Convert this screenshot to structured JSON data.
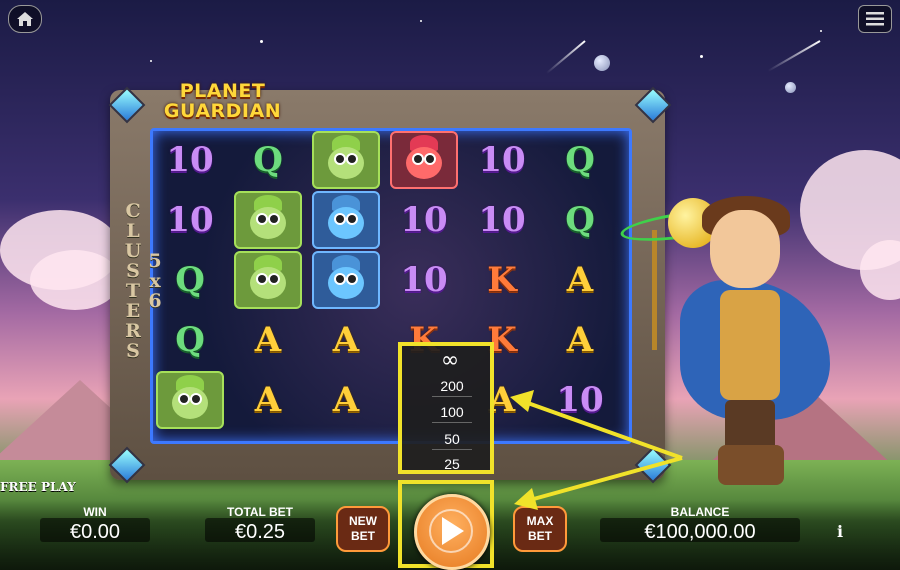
{
  "game": {
    "title_line1": "PLANET",
    "title_line2": "GUARDIAN",
    "side_label": "5x6 CLUSTERS"
  },
  "reels": [
    [
      "10",
      "Q",
      "creature-green",
      "creature-red",
      "10",
      "Q"
    ],
    [
      "10",
      "creature-green",
      "creature-blue",
      "10",
      "10",
      "Q"
    ],
    [
      "Q",
      "creature-green",
      "creature-blue",
      "10",
      "K",
      "A"
    ],
    [
      "Q",
      "A",
      "A",
      "K",
      "K",
      "A"
    ],
    [
      "creature-green",
      "A",
      "A",
      "",
      "A",
      "10"
    ]
  ],
  "autoplay": {
    "options": [
      "∞",
      "200",
      "100",
      "50",
      "25"
    ]
  },
  "bottom": {
    "free_play": "FREE PLAY",
    "win_label": "WIN",
    "win_value": "€0.00",
    "total_bet_label": "TOTAL BET",
    "total_bet_value": "€0.25",
    "new_bet_label_1": "NEW",
    "new_bet_label_2": "BET",
    "max_bet_label_1": "MAX",
    "max_bet_label_2": "BET",
    "balance_label": "BALANCE",
    "balance_value": "€100,000.00",
    "info": "i"
  },
  "icons": {
    "home": "home-icon",
    "menu": "hamburger-menu-icon",
    "spin": "play-icon"
  },
  "colors": {
    "highlight": "#f1e22a",
    "spin": "#e67a20",
    "frame_glow": "#3d79ff"
  }
}
